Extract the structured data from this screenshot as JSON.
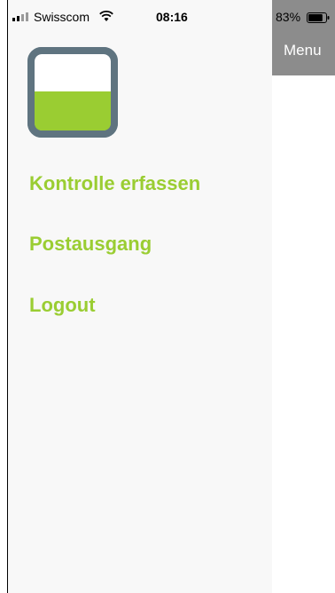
{
  "status_bar": {
    "carrier": "Swisscom",
    "time": "08:16",
    "battery_percent": "83%",
    "battery_level": 0.83,
    "icons": [
      "signal-icon",
      "wifi-icon",
      "battery-icon"
    ]
  },
  "header": {
    "menu_label": "Menu"
  },
  "logo": {
    "icon": "app-logo-icon",
    "colors": {
      "frame": "#5f7480",
      "fill_top": "#ffffff",
      "fill_bottom": "#9acd32"
    }
  },
  "drawer": {
    "items": [
      {
        "label": "Kontrolle erfassen"
      },
      {
        "label": "Postausgang"
      },
      {
        "label": "Logout"
      }
    ]
  },
  "colors": {
    "accent": "#9acd32",
    "drawer_background": "#f8f8f8",
    "header_background": "#8c8c8c"
  }
}
